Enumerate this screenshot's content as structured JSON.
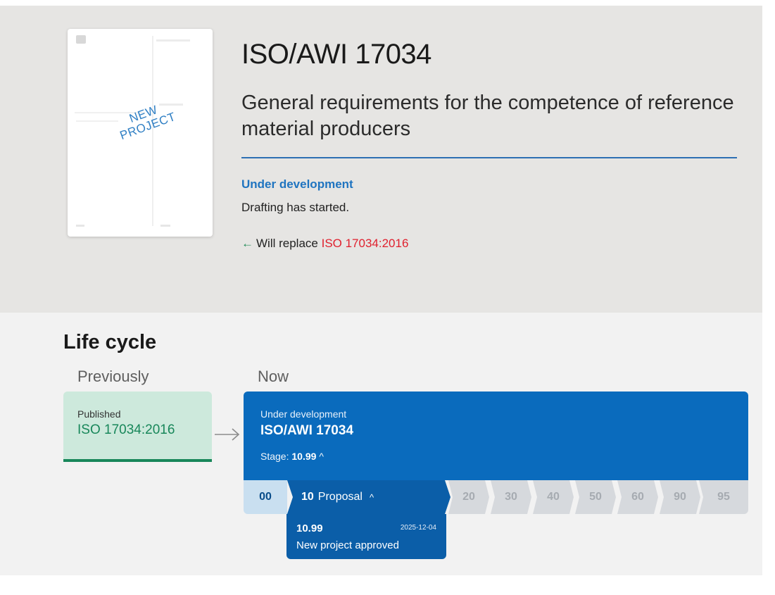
{
  "cover": {
    "stamp_line1": "NEW",
    "stamp_line2": "PROJECT"
  },
  "header": {
    "title": "ISO/AWI 17034",
    "subtitle": "General requirements for the competence of reference material producers",
    "status": "Under development",
    "status_description": "Drafting has started.",
    "replace_arrow": "←",
    "replace_text": "Will replace",
    "replace_link": "ISO 17034:2016"
  },
  "lifecycle": {
    "title": "Life cycle",
    "previously_label": "Previously",
    "now_label": "Now",
    "previous": {
      "status": "Published",
      "reference": "ISO 17034:2016"
    },
    "current": {
      "status": "Under development",
      "reference": "ISO/AWI 17034",
      "stage_label": "Stage:",
      "stage_value": "10.99",
      "stage_caret": "^"
    },
    "stages": {
      "s00": "00",
      "s10_code": "10",
      "s10_name": "Proposal",
      "s10_caret": "^",
      "s20": "20",
      "s30": "30",
      "s40": "40",
      "s50": "50",
      "s60": "60",
      "s90": "90",
      "s95": "95"
    },
    "substage": {
      "code": "10.99",
      "date": "2025-12-04",
      "description": "New project approved"
    }
  },
  "colors": {
    "accent_blue": "#0a6bbd",
    "published_green": "#18875a",
    "link_red": "#e0202e"
  }
}
